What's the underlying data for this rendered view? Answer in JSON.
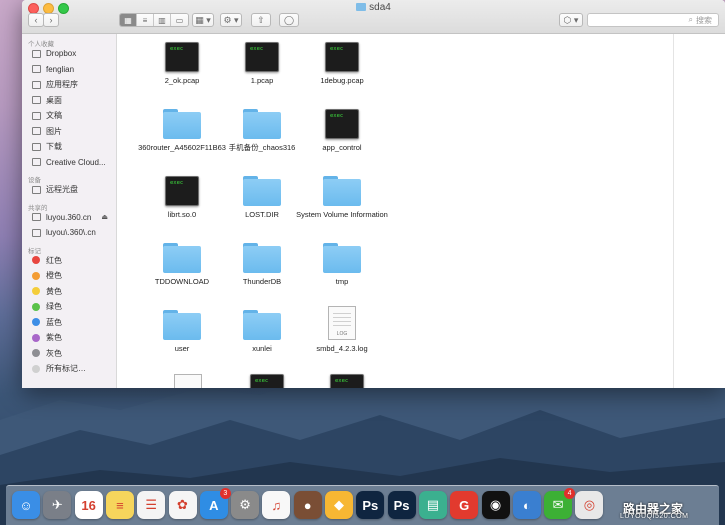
{
  "window": {
    "title": "sda4"
  },
  "toolbar": {
    "back_label": "‹",
    "forward_label": "›",
    "views": [
      "▦",
      "≡",
      "▥",
      "▭"
    ],
    "arrange_label": "▦ ▾",
    "action_label": "⚙ ▾",
    "share_label": "⇧",
    "tag_label": "◯",
    "dropbox_label": "⬡ ▾",
    "search_placeholder": "搜索"
  },
  "sidebar": {
    "favorites_header": "个人收藏",
    "favorites": [
      "Dropbox",
      "fenglian",
      "应用程序",
      "桌面",
      "文稿",
      "图片",
      "下载",
      "Creative Cloud..."
    ],
    "devices_header": "设备",
    "devices": [
      "远程光盘"
    ],
    "shared_header": "共享的",
    "shared": [
      "luyou.360.cn",
      "luyou\\.360\\.cn"
    ],
    "eject_label": "⏏",
    "tags_header": "标记",
    "tags": [
      {
        "label": "红色",
        "color": "#e8463f"
      },
      {
        "label": "橙色",
        "color": "#f39c34"
      },
      {
        "label": "黄色",
        "color": "#f4cd3a"
      },
      {
        "label": "绿色",
        "color": "#5ac24a"
      },
      {
        "label": "蓝色",
        "color": "#3d8ee6"
      },
      {
        "label": "紫色",
        "color": "#a866c9"
      },
      {
        "label": "灰色",
        "color": "#8e8e93"
      },
      {
        "label": "所有标记…",
        "color": "#d0d0d0"
      }
    ]
  },
  "files": [
    {
      "name": "2_ok.pcap",
      "type": "exec"
    },
    {
      "name": "1.pcap",
      "type": "exec"
    },
    {
      "name": "1debug.pcap",
      "type": "exec"
    },
    {
      "name": "360router_A45602F11B63",
      "type": "folder"
    },
    {
      "name": "手机备份_chaos316",
      "type": "folder"
    },
    {
      "name": "app_control",
      "type": "exec"
    },
    {
      "name": "librt.so.0",
      "type": "exec"
    },
    {
      "name": "LOST.DIR",
      "type": "folder"
    },
    {
      "name": "System Volume Information",
      "type": "folder"
    },
    {
      "name": "TDDOWNLOAD",
      "type": "folder"
    },
    {
      "name": "ThunderDB",
      "type": "folder"
    },
    {
      "name": "tmp",
      "type": "folder"
    },
    {
      "name": "user",
      "type": "folder"
    },
    {
      "name": "xunlei",
      "type": "folder"
    },
    {
      "name": "smbd_4.2.3.log",
      "type": "log"
    }
  ],
  "exec_label": "exec",
  "log_label": "LOG",
  "dock": {
    "apps": [
      {
        "name": "Finder",
        "glyph": "☺",
        "color": "#3a8ee6"
      },
      {
        "name": "Launchpad",
        "glyph": "✈",
        "color": "#7a7f88"
      },
      {
        "name": "Calendar",
        "glyph": "16",
        "color": "#ffffff"
      },
      {
        "name": "Notes",
        "glyph": "≡",
        "color": "#f6d55c"
      },
      {
        "name": "Reminders",
        "glyph": "☰",
        "color": "#f4f4f4"
      },
      {
        "name": "Photos",
        "glyph": "✿",
        "color": "#f5f5f5"
      },
      {
        "name": "App Store",
        "glyph": "A",
        "color": "#2f8de4",
        "badge": "3"
      },
      {
        "name": "System Preferences",
        "glyph": "⚙",
        "color": "#8a8a8a"
      },
      {
        "name": "iTunes",
        "glyph": "♫",
        "color": "#f8f8f8"
      },
      {
        "name": "Basketball",
        "glyph": "●",
        "color": "#7a4e35"
      },
      {
        "name": "Sketch",
        "glyph": "◆",
        "color": "#f7b733"
      },
      {
        "name": "Photoshop",
        "glyph": "Ps",
        "color": "#0f2540"
      },
      {
        "name": "Photoshop 2",
        "glyph": "Ps",
        "color": "#0f2540"
      },
      {
        "name": "Pinta",
        "glyph": "▤",
        "color": "#3bb08f"
      },
      {
        "name": "Gm",
        "glyph": "G",
        "color": "#e23a2e"
      },
      {
        "name": "QQ",
        "glyph": "◉",
        "color": "#111111"
      },
      {
        "name": "Browser",
        "glyph": "◐",
        "color": "#3a7fd0"
      },
      {
        "name": "WeChat",
        "glyph": "✉",
        "color": "#3cb035",
        "badge": "4"
      },
      {
        "name": "Chrome",
        "glyph": "◎",
        "color": "#e8e8e8"
      }
    ]
  },
  "watermark": {
    "text": "路由器之家",
    "url": "LUYOUQI520.COM"
  },
  "colors": {
    "folder": "#7cc3f0",
    "sidebar_bg": "#f3f0f4",
    "accent": "#3d8ee6"
  }
}
